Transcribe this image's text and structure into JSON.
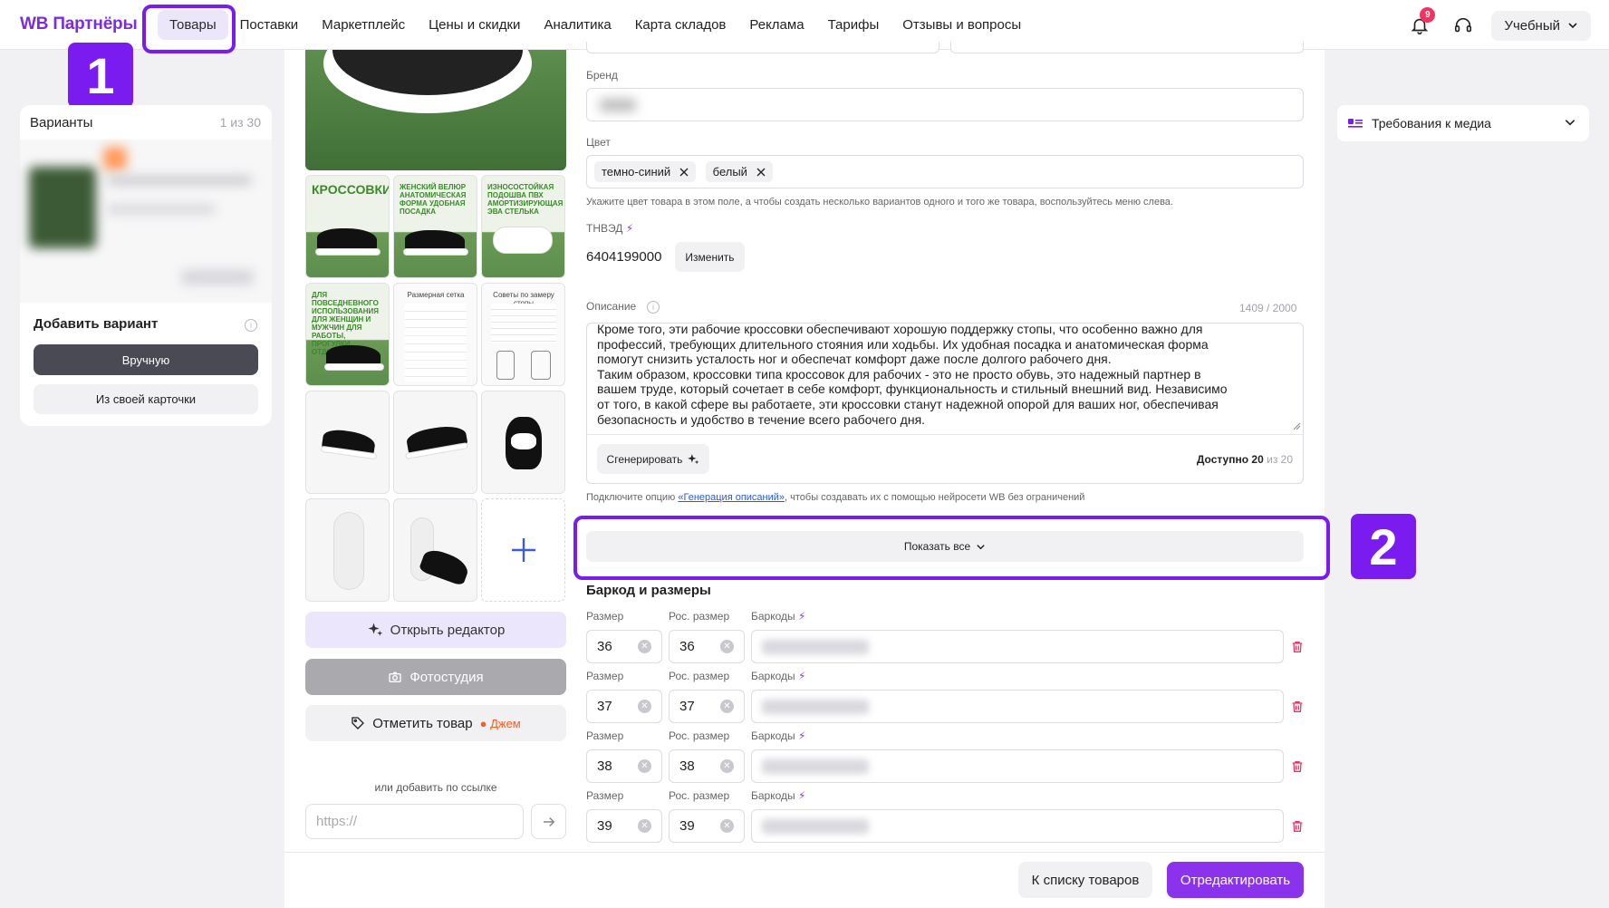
{
  "header": {
    "logo": "WB Партнёры",
    "nav": [
      "Товары",
      "Поставки",
      "Маркетплейс",
      "Цены и скидки",
      "Аналитика",
      "Карта складов",
      "Реклама",
      "Тарифы",
      "Отзывы и вопросы"
    ],
    "notifications_count": "9",
    "account": "Учебный"
  },
  "markers": {
    "one": "1",
    "two": "2"
  },
  "variants": {
    "title": "Варианты",
    "count": "1 из 30",
    "add_title": "Добавить вариант",
    "btn_manual": "Вручную",
    "btn_from_card": "Из своей карточки"
  },
  "media": {
    "thumb_texts": [
      "КРОССОВКИ",
      "ЖЕНСКИЙ ВЕЛЮР АНАТОМИЧЕСКАЯ ФОРМА УДОБНАЯ ПОСАДКА",
      "ИЗНОСОСТОЙКАЯ ПОДОШВА ПВХ АМОРТИЗИРУЮЩАЯ ЭВА СТЕЛЬКА",
      "ДЛЯ ПОВСЕДНЕВНОГО ИСПОЛЬЗОВАНИЯ ДЛЯ ЖЕНЩИН И МУЖЧИН ДЛЯ РАБОТЫ, ПРОГУЛКИ, ОТДЫХА",
      "Размерная сетка",
      "Советы по замеру стопы"
    ],
    "btn_editor": "Открыть редактор",
    "btn_studio": "Фотостудия",
    "btn_mark": "Отметить товар",
    "jam": "Джем",
    "or_link": "или добавить по ссылке",
    "url_placeholder": "https://"
  },
  "form": {
    "brand_label": "Бренд",
    "color_label": "Цвет",
    "colors": [
      "темно-синий",
      "белый"
    ],
    "color_hint": "Укажите цвет товара в этом поле, а чтобы создать несколько вариантов одного и того же товара, воспользуйтесь меню слева.",
    "tnved_label": "ТНВЭД",
    "tnved_value": "6404199000",
    "btn_change": "Изменить",
    "desc_label": "Описание",
    "desc_counter": "1409 / 2000",
    "desc_lines": [
      "Кроме того, эти рабочие кроссовки обеспечивают хорошую поддержку стопы, что особенно важно для",
      "профессий, требующих длительного стояния или ходьбы. Их удобная посадка и анатомическая форма",
      "помогут снизить усталость ног и обеспечат комфорт даже после долгого рабочего дня.",
      "Таким образом, кроссовки типа кроссовок для рабочих - это не просто обувь, это надежный партнер в",
      "вашем труде, который сочетает в себе комфорт, функциональность и стильный внешний вид. Независимо",
      "от того, в какой сфере вы работаете, эти кроссовки станут надежной опорой для ваших ног, обеспечивая",
      "безопасность и удобство в течение всего рабочего дня."
    ],
    "btn_generate": "Сгенерировать",
    "avail_prefix": "Доступно",
    "avail_num": "20",
    "avail_suffix": "из 20",
    "gen_hint_pre": "Подключите опцию",
    "gen_hint_link": "«Генерация описаний»",
    "gen_hint_post": ", чтобы создавать их с помощью нейросети WB без ограничений",
    "show_all": "Показать все"
  },
  "sizes": {
    "title": "Баркод и размеры",
    "size_label": "Размер",
    "ros_label": "Рос. размер",
    "barcode_label": "Баркоды",
    "rows": [
      {
        "size": "36",
        "ros": "36"
      },
      {
        "size": "37",
        "ros": "37"
      },
      {
        "size": "38",
        "ros": "38"
      },
      {
        "size": "39",
        "ros": "39"
      }
    ]
  },
  "footer": {
    "btn_back": "К списку товаров",
    "btn_edit": "Отредактировать"
  },
  "right": {
    "media_requirements": "Требования к медиа"
  },
  "colors": {
    "accent": "#7a1cf0",
    "brand": "#7b2ce0",
    "primary_btn": "#8b33ec",
    "danger": "#f5315f"
  }
}
